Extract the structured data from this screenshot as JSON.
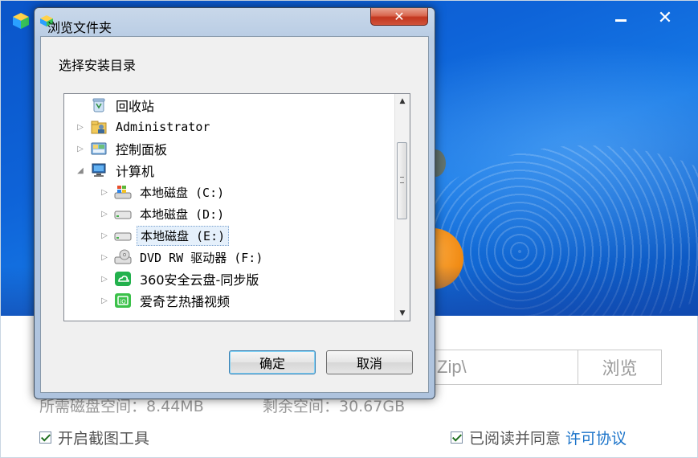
{
  "installer": {
    "path_value": "Zip\\",
    "browse_label": "浏览",
    "required_space": "所需磁盘空间：8.44MB",
    "free_space": "剩余空间：30.67GB",
    "screenshot_tool_label": "开启截图工具",
    "agree_label": "已阅读并同意",
    "license_link": "许可协议",
    "minimize_icon": "minimize-icon",
    "close_label": "✕"
  },
  "dialog": {
    "title": "浏览文件夹",
    "close_label": "✕",
    "prompt": "选择安装目录",
    "ok_label": "确定",
    "cancel_label": "取消",
    "tree": [
      {
        "label": "回收站",
        "icon": "recycle-bin-icon",
        "level": 0,
        "expander": "none"
      },
      {
        "label": "Administrator",
        "icon": "user-folder-icon",
        "level": 0,
        "expander": "collapsed"
      },
      {
        "label": "控制面板",
        "icon": "control-panel-icon",
        "level": 0,
        "expander": "collapsed"
      },
      {
        "label": "计算机",
        "icon": "computer-icon",
        "level": 0,
        "expander": "expanded"
      },
      {
        "label": "本地磁盘 (C:)",
        "icon": "system-drive-icon",
        "level": 1,
        "expander": "collapsed"
      },
      {
        "label": "本地磁盘 (D:)",
        "icon": "drive-icon",
        "level": 1,
        "expander": "collapsed"
      },
      {
        "label": "本地磁盘 (E:)",
        "icon": "drive-icon",
        "level": 1,
        "expander": "collapsed",
        "selected": true
      },
      {
        "label": "DVD RW 驱动器 (F:)",
        "icon": "dvd-drive-icon",
        "level": 1,
        "expander": "collapsed"
      },
      {
        "label": "360安全云盘-同步版",
        "icon": "cloud-drive-icon",
        "level": 1,
        "expander": "collapsed"
      },
      {
        "label": "爱奇艺热播视频",
        "icon": "video-app-icon",
        "level": 1,
        "expander": "collapsed"
      }
    ]
  },
  "colors": {
    "banner_blue": "#0e63d8",
    "link_blue": "#1a73c9",
    "accent_orange": "#f08a12",
    "dialog_frame": "#b8cce4"
  }
}
